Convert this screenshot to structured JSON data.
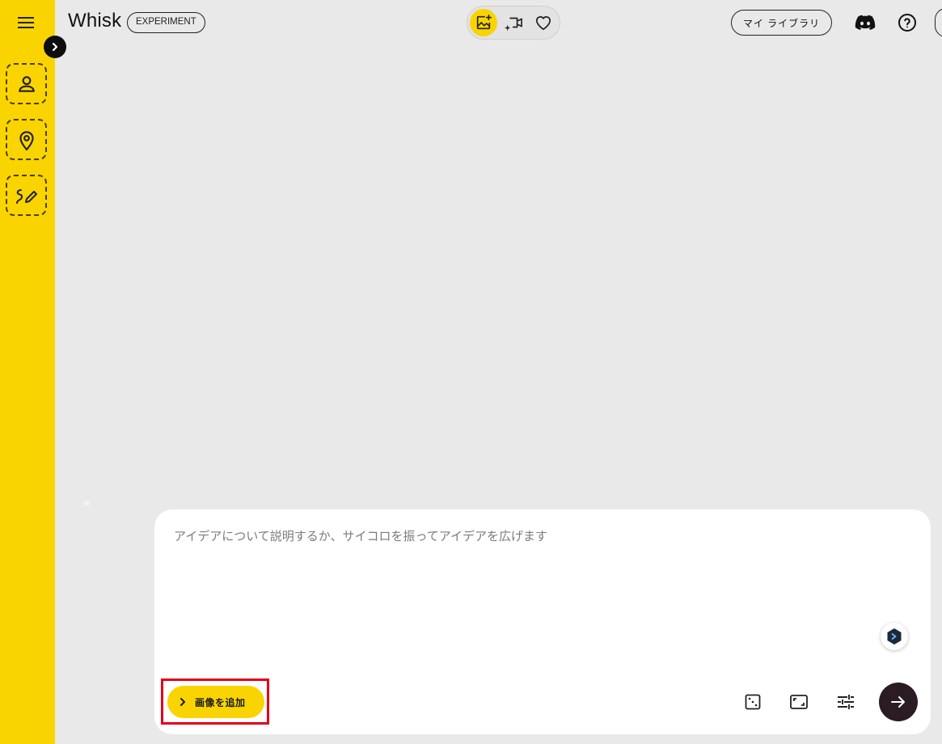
{
  "colors": {
    "accent": "#fad400",
    "canvas": "#e9e9e9",
    "highlight": "#e2001a",
    "submit": "#2a1c22"
  },
  "header": {
    "brand": "Whisk",
    "badge": "EXPERIMENT",
    "library_label": "マイ ライブラリ",
    "mode_icons": [
      "image-sparkle-icon",
      "video-sparkle-icon",
      "heart-icon"
    ],
    "right_icons": [
      "discord-icon",
      "help-icon"
    ]
  },
  "sidebar": {
    "menu_icon": "hamburger-icon",
    "expand_icon": "chevron-right-icon",
    "slots": [
      {
        "icon": "person-icon"
      },
      {
        "icon": "location-pin-icon"
      },
      {
        "icon": "brush-icon"
      }
    ]
  },
  "prompt": {
    "placeholder": "アイデアについて説明するか、サイコロを振ってアイデアを広げます",
    "value": "",
    "add_image_label": "画像を追加",
    "tools": [
      "dice-icon",
      "aspect-ratio-icon",
      "tune-icon"
    ],
    "submit_icon": "arrow-right-icon"
  }
}
